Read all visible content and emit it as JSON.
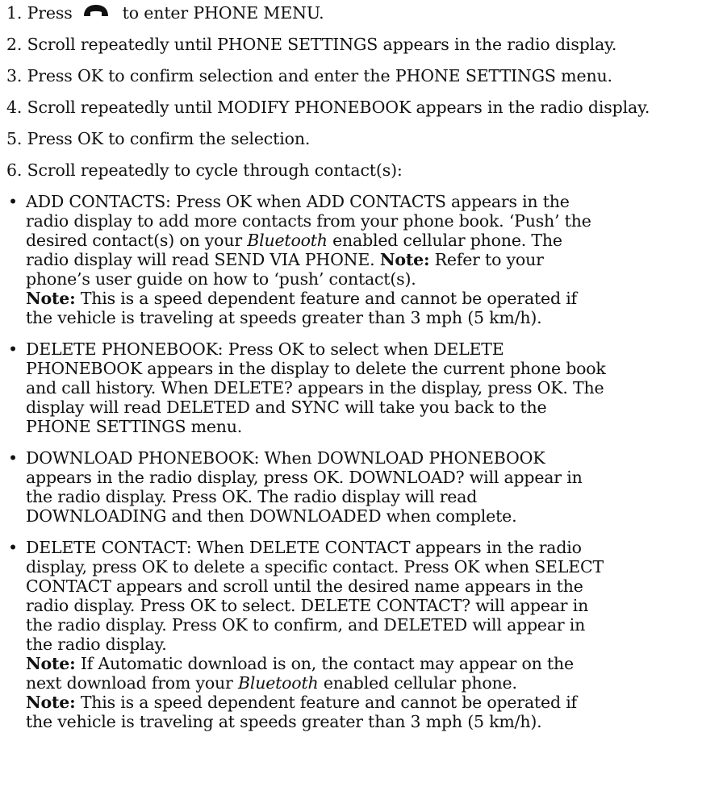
{
  "steps": [
    {
      "number": "1.",
      "before_icon": "Press",
      "icon": "phone-handset-icon",
      "after_icon": "to enter PHONE MENU."
    },
    {
      "number": "2.",
      "text": "Scroll repeatedly until PHONE SETTINGS appears in the radio display."
    },
    {
      "number": "3.",
      "text": "Press OK to confirm selection and enter the PHONE SETTINGS menu."
    },
    {
      "number": "4.",
      "text": "Scroll repeatedly until MODIFY PHONEBOOK appears in the radio display."
    },
    {
      "number": "5.",
      "text": "Press OK to confirm the selection."
    },
    {
      "number": "6.",
      "text": "Scroll repeatedly to cycle through contact(s):"
    }
  ],
  "bullet_char": "•",
  "note_label": "Note:",
  "bluetooth": "Bluetooth",
  "add_contacts": {
    "l1": "ADD CONTACTS: Press OK when ADD CONTACTS appears in the",
    "l2": "radio display to add more contacts from your phone book. ‘Push’ the",
    "l3a": "desired contact(s) on your",
    "l3b": "enabled cellular phone. The",
    "l4a": "radio display will read SEND VIA PHONE.",
    "l4b": "Refer to your",
    "l5": "phone’s user guide on how to ‘push’ contact(s).",
    "l6": "This is a speed dependent feature and cannot be operated if",
    "l7": "the vehicle is traveling at speeds greater than 3 mph (5 km/h)."
  },
  "delete_phonebook": {
    "l1": "DELETE PHONEBOOK: Press OK to select when DELETE",
    "l2": "PHONEBOOK appears in the display to delete the current phone book",
    "l3": "and call history. When DELETE? appears in the display, press OK. The",
    "l4": "display will read DELETED and SYNC will take you back to the",
    "l5": "PHONE SETTINGS menu."
  },
  "download_phonebook": {
    "l1": "DOWNLOAD PHONEBOOK: When DOWNLOAD PHONEBOOK",
    "l2": "appears in the radio display, press OK. DOWNLOAD? will appear in",
    "l3": "the radio display. Press OK. The radio display will read",
    "l4": "DOWNLOADING and then DOWNLOADED when complete."
  },
  "delete_contact": {
    "l1": "DELETE CONTACT: When DELETE CONTACT appears in the radio",
    "l2": "display, press OK to delete a specific contact. Press OK when SELECT",
    "l3": "CONTACT appears and scroll until the desired name appears in the",
    "l4": "radio display. Press OK to select. DELETE CONTACT? will appear in",
    "l5": "the radio display. Press OK to confirm, and DELETED will appear in",
    "l6": "the radio display.",
    "l7": "If Automatic download is on, the contact may appear on the",
    "l8a": "next download from your",
    "l8b": "enabled cellular phone.",
    "l9": "This is a speed dependent feature and cannot be operated if",
    "l10": "the vehicle is traveling at speeds greater than 3 mph (5 km/h)."
  }
}
